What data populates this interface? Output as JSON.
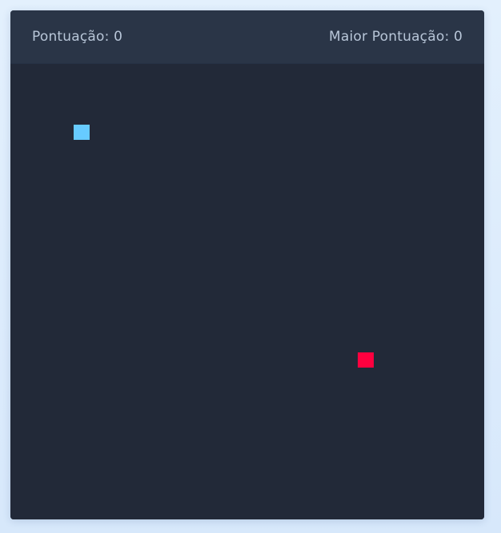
{
  "header": {
    "score_label": "Pontuação: 0",
    "high_score_label": "Maior Pontuação: 0"
  },
  "game": {
    "score": 0,
    "high_score": 0,
    "colors": {
      "page_background": "#dcebfb",
      "header_background": "#2a3547",
      "board_background": "#222938",
      "score_text": "#b8c6d8",
      "snake": "#67cbff",
      "food": "#ff003f"
    },
    "pieces": {
      "snake": "snake-segment",
      "food": "food-item"
    }
  }
}
